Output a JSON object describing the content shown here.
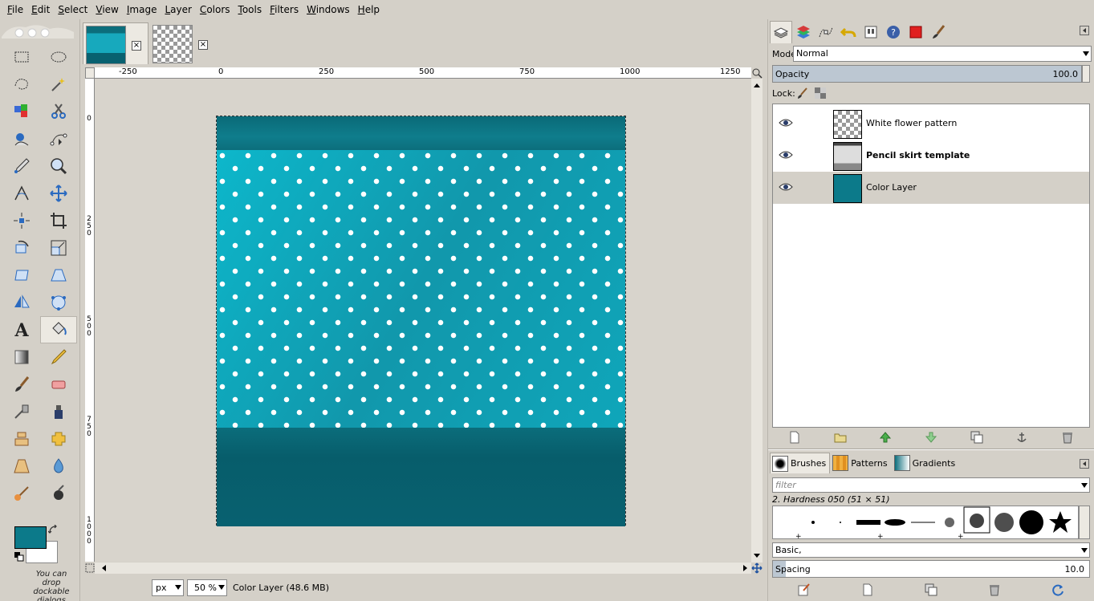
{
  "menu": [
    "File",
    "Edit",
    "Select",
    "View",
    "Image",
    "Layer",
    "Colors",
    "Tools",
    "Filters",
    "Windows",
    "Help"
  ],
  "toolbox": {
    "tools": [
      "rect-select-icon",
      "ellipse-select-icon",
      "free-select-icon",
      "fuzzy-select-icon",
      "select-by-color-icon",
      "scissors-icon",
      "foreground-select-icon",
      "paths-icon",
      "color-picker-icon",
      "zoom-icon",
      "measure-icon",
      "move-icon",
      "align-icon",
      "crop-icon",
      "rotate-icon",
      "scale-icon",
      "shear-icon",
      "perspective-icon",
      "flip-icon",
      "cage-icon",
      "text-icon",
      "bucket-fill-icon",
      "blend-icon",
      "pencil-icon",
      "paintbrush-icon",
      "eraser-icon",
      "airbrush-icon",
      "ink-icon",
      "clone-icon",
      "heal-icon",
      "perspective-clone-icon",
      "blur-icon",
      "smudge-icon",
      "dodge-burn-icon"
    ],
    "active_tool_index": 21,
    "fg_color": "#0c7a8a",
    "bg_color": "#ffffff",
    "dock_hint": "You can drop dockable dialogs here"
  },
  "rulers": {
    "h_labels": [
      "-250",
      "0",
      "250",
      "500",
      "750",
      "1000",
      "1250"
    ],
    "v_labels": [
      "0",
      "250",
      "500",
      "750",
      "1000"
    ]
  },
  "statusbar": {
    "unit": "px",
    "zoom": "50 %",
    "text": "Color Layer (48.6 MB)"
  },
  "layers_panel": {
    "mode_label": "Mode:",
    "mode_value": "Normal",
    "opacity_label": "Opacity",
    "opacity_value": "100.0",
    "lock_label": "Lock:",
    "layers": [
      {
        "name": "White flower pattern",
        "bold": false,
        "selected": false
      },
      {
        "name": "Pencil skirt template",
        "bold": true,
        "selected": false
      },
      {
        "name": "Color Layer",
        "bold": false,
        "selected": true
      }
    ]
  },
  "brushes_panel": {
    "tabs": [
      "Brushes",
      "Patterns",
      "Gradients"
    ],
    "filter_placeholder": "filter",
    "brush_name": "2. Hardness 050 (51 × 51)",
    "tag": "Basic,",
    "spacing_label": "Spacing",
    "spacing_value": "10.0"
  },
  "colors": {
    "teal_dark": "#086170",
    "teal_pattern": "#17a9bd",
    "selection_blue": "#bcc7d2"
  }
}
